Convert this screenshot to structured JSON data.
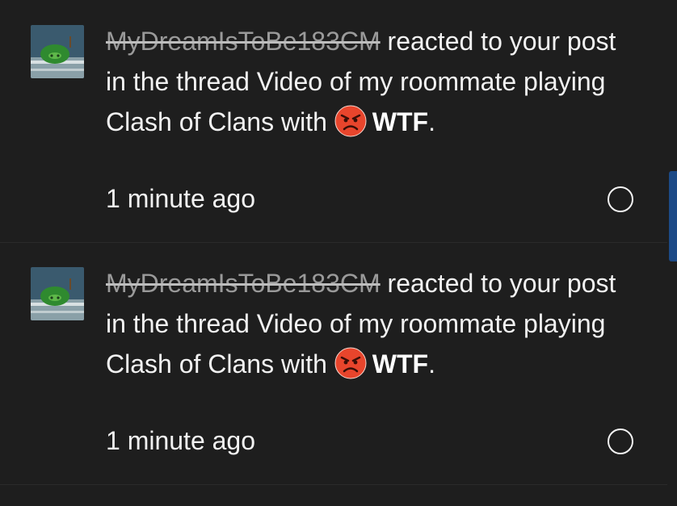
{
  "notifications": [
    {
      "username": "MyDreamIsToBe183CM",
      "text_part1": "reacted to your post in the thread Video of my roommate playing Clash of Clans with",
      "reaction_icon": "angry-face-icon",
      "reaction_name": "WTF",
      "punctuation": ".",
      "time": "1 minute ago"
    },
    {
      "username": "MyDreamIsToBe183CM",
      "text_part1": "reacted to your post in the thread Video of my roommate playing Clash of Clans with",
      "reaction_icon": "angry-face-icon",
      "reaction_name": "WTF",
      "punctuation": ".",
      "time": "1 minute ago"
    }
  ],
  "colors": {
    "background": "#1e1e1e",
    "text": "#f2f2f2",
    "username_struck": "#9a9a9a",
    "reaction_red": "#e8452c",
    "scrollbar": "#1c4a86"
  }
}
